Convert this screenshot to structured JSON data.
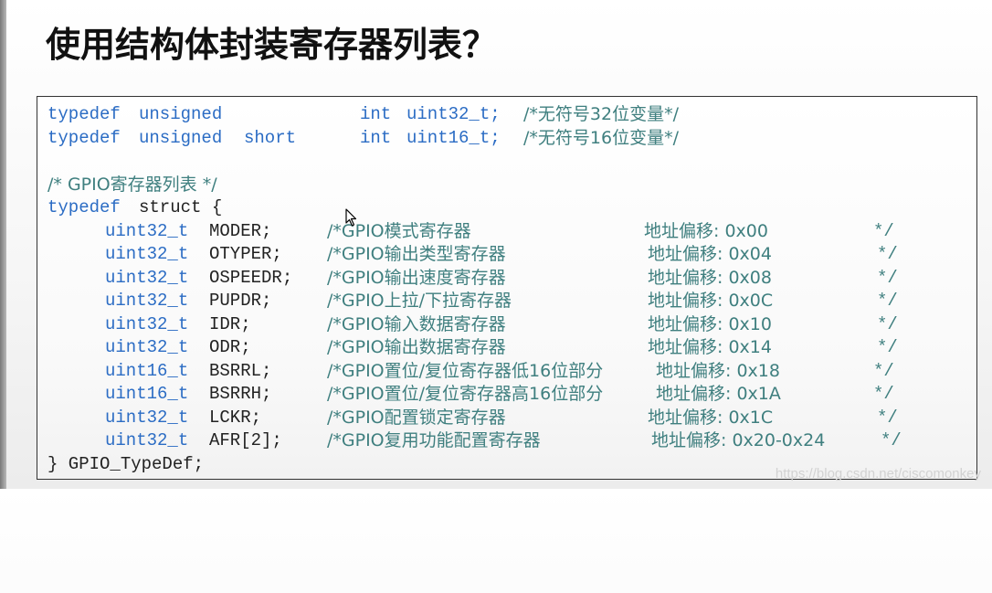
{
  "slide": {
    "title": "使用结构体封装寄存器列表？"
  },
  "code": {
    "typedef1": {
      "kw1": "typedef",
      "kw2": "unsigned",
      "kw3": "int",
      "name": "uint32_t;",
      "comment": "/*无符号32位变量*/"
    },
    "typedef2": {
      "kw1": "typedef",
      "kw2": "unsigned",
      "kw2b": "short",
      "kw3": "int",
      "name": "uint16_t;",
      "comment": "/*无符号16位变量*/"
    },
    "struct_comment": "/* GPIO寄存器列表 */",
    "struct_kw": "typedef",
    "struct_open": "struct {",
    "members": [
      {
        "type": "uint32_t",
        "name": "MODER;",
        "comment": "/*GPIO模式寄存器",
        "offset": "地址偏移: 0x00",
        "end": "*/"
      },
      {
        "type": "uint32_t",
        "name": "OTYPER;",
        "comment": "/*GPIO输出类型寄存器",
        "offset": "地址偏移: 0x04",
        "end": "*/"
      },
      {
        "type": "uint32_t",
        "name": "OSPEEDR;",
        "comment": "/*GPIO输出速度寄存器",
        "offset": "地址偏移: 0x08",
        "end": "*/"
      },
      {
        "type": "uint32_t",
        "name": "PUPDR;",
        "comment": "/*GPIO上拉/下拉寄存器",
        "offset": "地址偏移: 0x0C",
        "end": "*/"
      },
      {
        "type": "uint32_t",
        "name": "IDR;",
        "comment": "/*GPIO输入数据寄存器",
        "offset": "地址偏移: 0x10",
        "end": "*/"
      },
      {
        "type": "uint32_t",
        "name": "ODR;",
        "comment": "/*GPIO输出数据寄存器",
        "offset": "地址偏移: 0x14",
        "end": "*/"
      },
      {
        "type": "uint16_t",
        "name": "BSRRL;",
        "comment": "/*GPIO置位/复位寄存器低16位部分",
        "offset": "地址偏移: 0x18",
        "end": "*/"
      },
      {
        "type": "uint16_t",
        "name": "BSRRH;",
        "comment": "/*GPIO置位/复位寄存器高16位部分",
        "offset": "地址偏移: 0x1A",
        "end": "*/"
      },
      {
        "type": "uint32_t",
        "name": "LCKR;",
        "comment": "/*GPIO配置锁定寄存器",
        "offset": "地址偏移: 0x1C",
        "end": "*/"
      },
      {
        "type": "uint32_t",
        "name": "AFR[2];",
        "comment": "/*GPIO复用功能配置寄存器",
        "offset": "地址偏移: 0x20-0x24",
        "end": "*/"
      }
    ],
    "struct_close": "} GPIO_TypeDef;"
  },
  "watermark": "https://blog.csdn.net/ciscomonkey"
}
